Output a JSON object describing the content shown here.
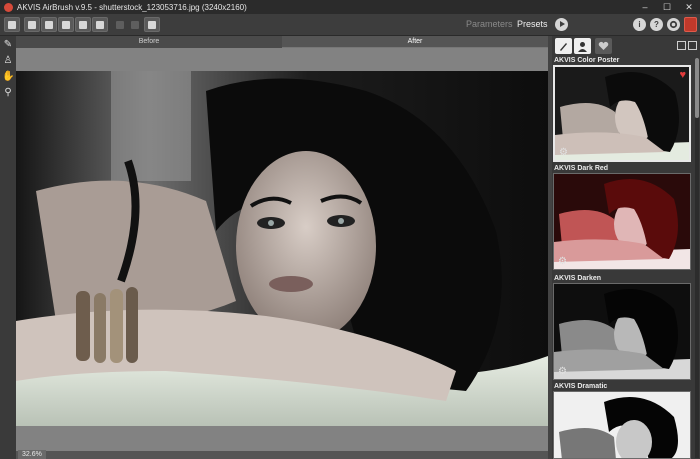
{
  "window": {
    "title": "AKVIS AirBrush v.9.5 - shutterstock_123053716.jpg (3240x2160)",
    "minimize": "–",
    "maximize": "☐",
    "close": "✕"
  },
  "toolbar": {
    "buttons": [
      "home-icon",
      "open-icon",
      "save-icon",
      "print-icon",
      "batch-icon",
      "share-icon",
      "undo-icon",
      "redo-icon",
      "frame-icon"
    ],
    "parameters_label": "Parameters",
    "presets_label": "Presets",
    "info_label": "i",
    "help_label": "?"
  },
  "tools": [
    "airbrush-tool-icon",
    "stamp-tool-icon",
    "hand-tool-icon",
    "zoom-tool-icon"
  ],
  "view_tabs": {
    "before": "Before",
    "after": "After",
    "active": "After"
  },
  "status": {
    "zoom": "32.6%"
  },
  "presets_panel": {
    "accent": "#e23b3b",
    "items": [
      {
        "name": "AKVIS Color Poster",
        "favorite": true,
        "selected": true
      },
      {
        "name": "AKVIS Dark Red",
        "favorite": false,
        "selected": false
      },
      {
        "name": "AKVIS Darken",
        "favorite": false,
        "selected": false
      },
      {
        "name": "AKVIS Dramatic",
        "favorite": false,
        "selected": false
      }
    ]
  }
}
